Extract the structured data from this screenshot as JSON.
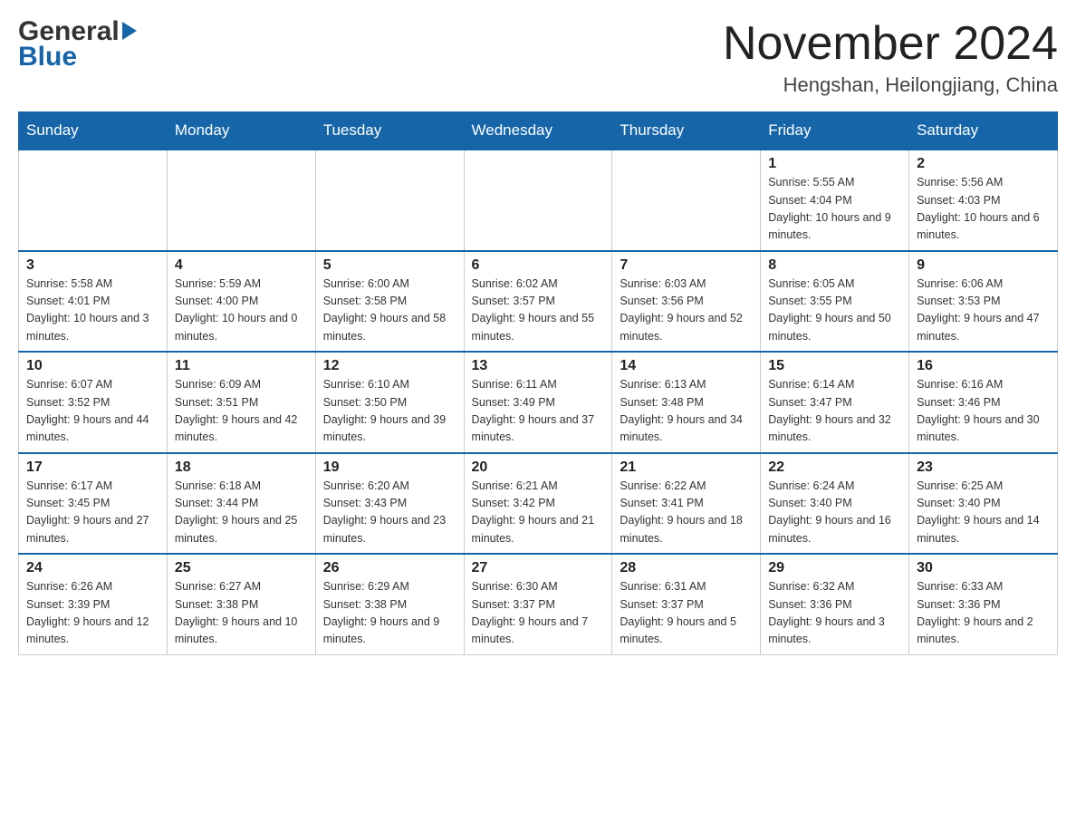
{
  "header": {
    "logo_general": "General",
    "logo_blue": "Blue",
    "title": "November 2024",
    "subtitle": "Hengshan, Heilongjiang, China"
  },
  "weekdays": [
    "Sunday",
    "Monday",
    "Tuesday",
    "Wednesday",
    "Thursday",
    "Friday",
    "Saturday"
  ],
  "weeks": [
    [
      {
        "day": "",
        "sunrise": "",
        "sunset": "",
        "daylight": ""
      },
      {
        "day": "",
        "sunrise": "",
        "sunset": "",
        "daylight": ""
      },
      {
        "day": "",
        "sunrise": "",
        "sunset": "",
        "daylight": ""
      },
      {
        "day": "",
        "sunrise": "",
        "sunset": "",
        "daylight": ""
      },
      {
        "day": "",
        "sunrise": "",
        "sunset": "",
        "daylight": ""
      },
      {
        "day": "1",
        "sunrise": "Sunrise: 5:55 AM",
        "sunset": "Sunset: 4:04 PM",
        "daylight": "Daylight: 10 hours and 9 minutes."
      },
      {
        "day": "2",
        "sunrise": "Sunrise: 5:56 AM",
        "sunset": "Sunset: 4:03 PM",
        "daylight": "Daylight: 10 hours and 6 minutes."
      }
    ],
    [
      {
        "day": "3",
        "sunrise": "Sunrise: 5:58 AM",
        "sunset": "Sunset: 4:01 PM",
        "daylight": "Daylight: 10 hours and 3 minutes."
      },
      {
        "day": "4",
        "sunrise": "Sunrise: 5:59 AM",
        "sunset": "Sunset: 4:00 PM",
        "daylight": "Daylight: 10 hours and 0 minutes."
      },
      {
        "day": "5",
        "sunrise": "Sunrise: 6:00 AM",
        "sunset": "Sunset: 3:58 PM",
        "daylight": "Daylight: 9 hours and 58 minutes."
      },
      {
        "day": "6",
        "sunrise": "Sunrise: 6:02 AM",
        "sunset": "Sunset: 3:57 PM",
        "daylight": "Daylight: 9 hours and 55 minutes."
      },
      {
        "day": "7",
        "sunrise": "Sunrise: 6:03 AM",
        "sunset": "Sunset: 3:56 PM",
        "daylight": "Daylight: 9 hours and 52 minutes."
      },
      {
        "day": "8",
        "sunrise": "Sunrise: 6:05 AM",
        "sunset": "Sunset: 3:55 PM",
        "daylight": "Daylight: 9 hours and 50 minutes."
      },
      {
        "day": "9",
        "sunrise": "Sunrise: 6:06 AM",
        "sunset": "Sunset: 3:53 PM",
        "daylight": "Daylight: 9 hours and 47 minutes."
      }
    ],
    [
      {
        "day": "10",
        "sunrise": "Sunrise: 6:07 AM",
        "sunset": "Sunset: 3:52 PM",
        "daylight": "Daylight: 9 hours and 44 minutes."
      },
      {
        "day": "11",
        "sunrise": "Sunrise: 6:09 AM",
        "sunset": "Sunset: 3:51 PM",
        "daylight": "Daylight: 9 hours and 42 minutes."
      },
      {
        "day": "12",
        "sunrise": "Sunrise: 6:10 AM",
        "sunset": "Sunset: 3:50 PM",
        "daylight": "Daylight: 9 hours and 39 minutes."
      },
      {
        "day": "13",
        "sunrise": "Sunrise: 6:11 AM",
        "sunset": "Sunset: 3:49 PM",
        "daylight": "Daylight: 9 hours and 37 minutes."
      },
      {
        "day": "14",
        "sunrise": "Sunrise: 6:13 AM",
        "sunset": "Sunset: 3:48 PM",
        "daylight": "Daylight: 9 hours and 34 minutes."
      },
      {
        "day": "15",
        "sunrise": "Sunrise: 6:14 AM",
        "sunset": "Sunset: 3:47 PM",
        "daylight": "Daylight: 9 hours and 32 minutes."
      },
      {
        "day": "16",
        "sunrise": "Sunrise: 6:16 AM",
        "sunset": "Sunset: 3:46 PM",
        "daylight": "Daylight: 9 hours and 30 minutes."
      }
    ],
    [
      {
        "day": "17",
        "sunrise": "Sunrise: 6:17 AM",
        "sunset": "Sunset: 3:45 PM",
        "daylight": "Daylight: 9 hours and 27 minutes."
      },
      {
        "day": "18",
        "sunrise": "Sunrise: 6:18 AM",
        "sunset": "Sunset: 3:44 PM",
        "daylight": "Daylight: 9 hours and 25 minutes."
      },
      {
        "day": "19",
        "sunrise": "Sunrise: 6:20 AM",
        "sunset": "Sunset: 3:43 PM",
        "daylight": "Daylight: 9 hours and 23 minutes."
      },
      {
        "day": "20",
        "sunrise": "Sunrise: 6:21 AM",
        "sunset": "Sunset: 3:42 PM",
        "daylight": "Daylight: 9 hours and 21 minutes."
      },
      {
        "day": "21",
        "sunrise": "Sunrise: 6:22 AM",
        "sunset": "Sunset: 3:41 PM",
        "daylight": "Daylight: 9 hours and 18 minutes."
      },
      {
        "day": "22",
        "sunrise": "Sunrise: 6:24 AM",
        "sunset": "Sunset: 3:40 PM",
        "daylight": "Daylight: 9 hours and 16 minutes."
      },
      {
        "day": "23",
        "sunrise": "Sunrise: 6:25 AM",
        "sunset": "Sunset: 3:40 PM",
        "daylight": "Daylight: 9 hours and 14 minutes."
      }
    ],
    [
      {
        "day": "24",
        "sunrise": "Sunrise: 6:26 AM",
        "sunset": "Sunset: 3:39 PM",
        "daylight": "Daylight: 9 hours and 12 minutes."
      },
      {
        "day": "25",
        "sunrise": "Sunrise: 6:27 AM",
        "sunset": "Sunset: 3:38 PM",
        "daylight": "Daylight: 9 hours and 10 minutes."
      },
      {
        "day": "26",
        "sunrise": "Sunrise: 6:29 AM",
        "sunset": "Sunset: 3:38 PM",
        "daylight": "Daylight: 9 hours and 9 minutes."
      },
      {
        "day": "27",
        "sunrise": "Sunrise: 6:30 AM",
        "sunset": "Sunset: 3:37 PM",
        "daylight": "Daylight: 9 hours and 7 minutes."
      },
      {
        "day": "28",
        "sunrise": "Sunrise: 6:31 AM",
        "sunset": "Sunset: 3:37 PM",
        "daylight": "Daylight: 9 hours and 5 minutes."
      },
      {
        "day": "29",
        "sunrise": "Sunrise: 6:32 AM",
        "sunset": "Sunset: 3:36 PM",
        "daylight": "Daylight: 9 hours and 3 minutes."
      },
      {
        "day": "30",
        "sunrise": "Sunrise: 6:33 AM",
        "sunset": "Sunset: 3:36 PM",
        "daylight": "Daylight: 9 hours and 2 minutes."
      }
    ]
  ]
}
